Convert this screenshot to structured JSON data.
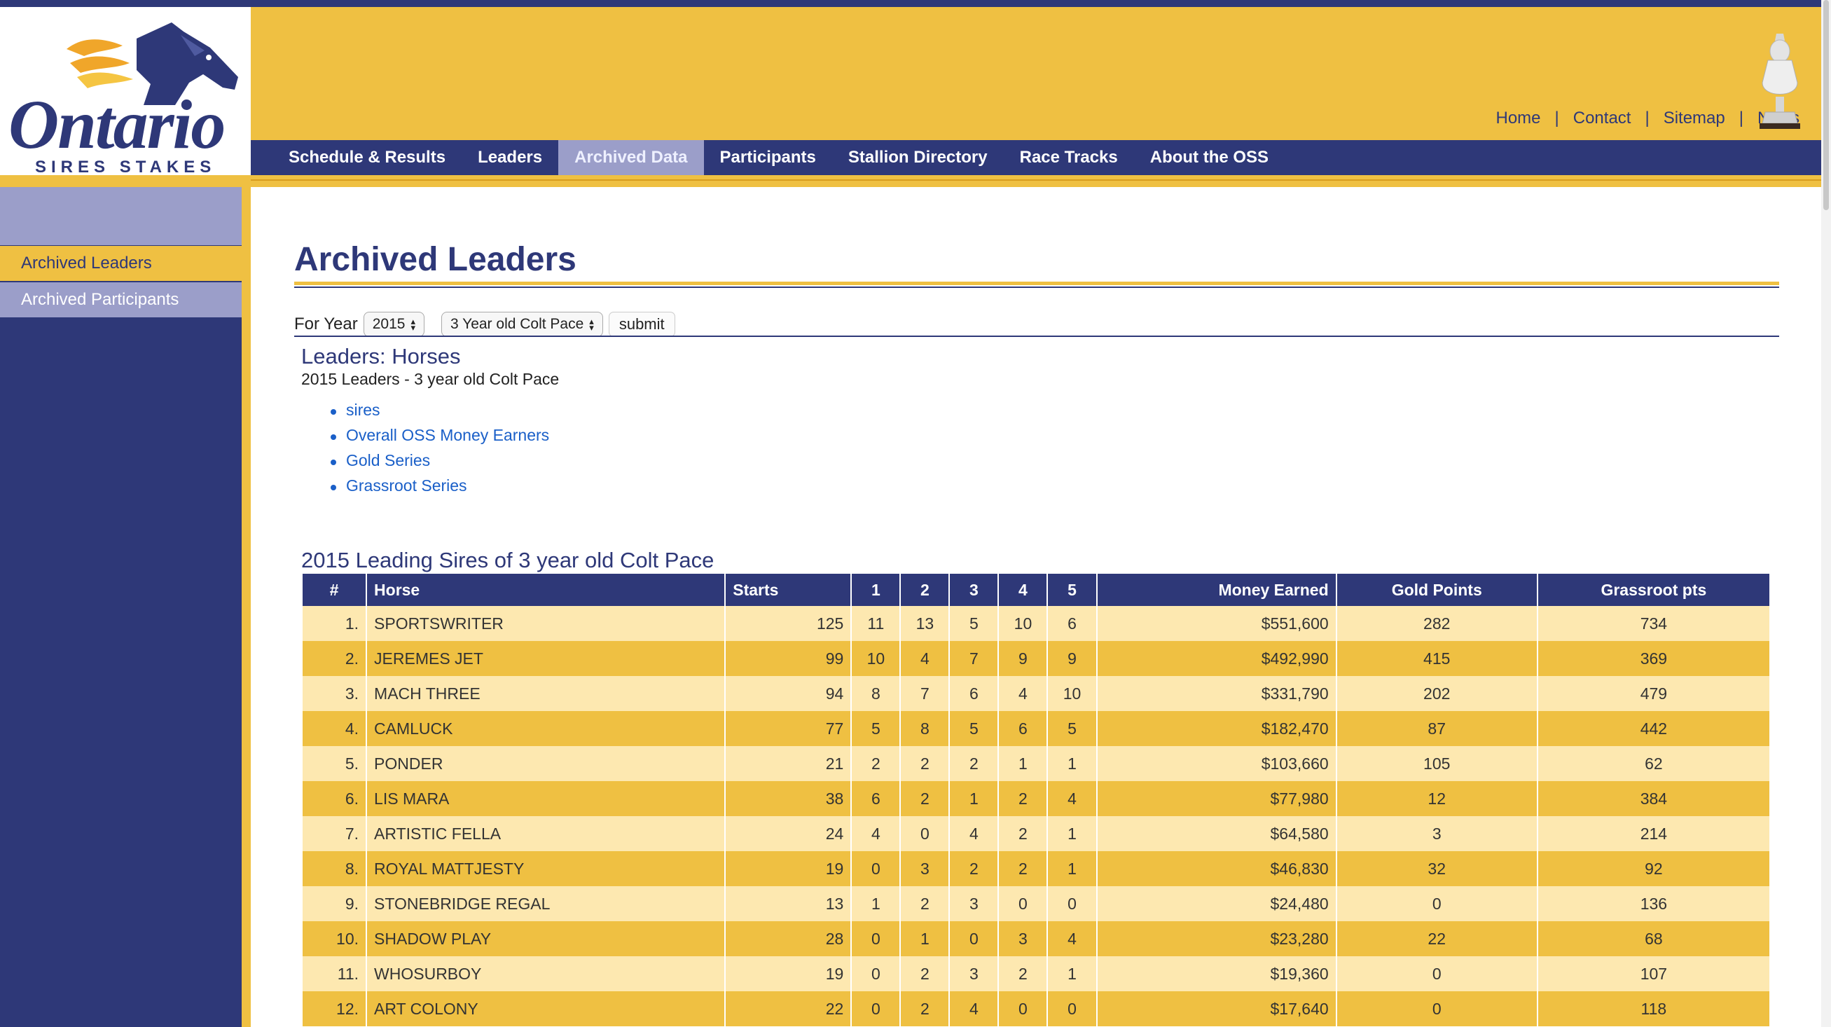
{
  "logo": {
    "brand": "Ontario",
    "tagline": "SIRES STAKES"
  },
  "util_nav": [
    "Home",
    "Contact",
    "Sitemap",
    "News"
  ],
  "main_nav": [
    {
      "label": "Schedule & Results",
      "active": false
    },
    {
      "label": "Leaders",
      "active": false
    },
    {
      "label": "Archived Data",
      "active": true
    },
    {
      "label": "Participants",
      "active": false
    },
    {
      "label": "Stallion Directory",
      "active": false
    },
    {
      "label": "Race Tracks",
      "active": false
    },
    {
      "label": "About the OSS",
      "active": false
    }
  ],
  "sidebar": {
    "items": [
      "Archived Leaders",
      "Archived Participants"
    ]
  },
  "page_title": "Archived Leaders",
  "filter": {
    "label": "For Year",
    "year": "2015",
    "category": "3 Year old Colt Pace",
    "submit": "submit"
  },
  "leaders": {
    "heading": "Leaders: Horses",
    "subheading": "2015 Leaders - 3 year old Colt Pace",
    "links": [
      "sires",
      "Overall OSS Money Earners",
      "Gold Series",
      "Grassroot Series"
    ]
  },
  "table": {
    "caption": "2015 Leading Sires of 3 year old Colt Pace",
    "headers": [
      "#",
      "Horse",
      "Starts",
      "1",
      "2",
      "3",
      "4",
      "5",
      "Money Earned",
      "Gold Points",
      "Grassroot pts"
    ],
    "rows": [
      [
        "1.",
        "SPORTSWRITER",
        "125",
        "11",
        "13",
        "5",
        "10",
        "6",
        "$551,600",
        "282",
        "734"
      ],
      [
        "2.",
        "JEREMES JET",
        "99",
        "10",
        "4",
        "7",
        "9",
        "9",
        "$492,990",
        "415",
        "369"
      ],
      [
        "3.",
        "MACH THREE",
        "94",
        "8",
        "7",
        "6",
        "4",
        "10",
        "$331,790",
        "202",
        "479"
      ],
      [
        "4.",
        "CAMLUCK",
        "77",
        "5",
        "8",
        "5",
        "6",
        "5",
        "$182,470",
        "87",
        "442"
      ],
      [
        "5.",
        "PONDER",
        "21",
        "2",
        "2",
        "2",
        "1",
        "1",
        "$103,660",
        "105",
        "62"
      ],
      [
        "6.",
        "LIS MARA",
        "38",
        "6",
        "2",
        "1",
        "2",
        "4",
        "$77,980",
        "12",
        "384"
      ],
      [
        "7.",
        "ARTISTIC FELLA",
        "24",
        "4",
        "0",
        "4",
        "2",
        "1",
        "$64,580",
        "3",
        "214"
      ],
      [
        "8.",
        "ROYAL MATTJESTY",
        "19",
        "0",
        "3",
        "2",
        "2",
        "1",
        "$46,830",
        "32",
        "92"
      ],
      [
        "9.",
        "STONEBRIDGE REGAL",
        "13",
        "1",
        "2",
        "3",
        "0",
        "0",
        "$24,480",
        "0",
        "136"
      ],
      [
        "10.",
        "SHADOW PLAY",
        "28",
        "0",
        "1",
        "0",
        "3",
        "4",
        "$23,280",
        "22",
        "68"
      ],
      [
        "11.",
        "WHOSURBOY",
        "19",
        "0",
        "2",
        "3",
        "2",
        "1",
        "$19,360",
        "0",
        "107"
      ],
      [
        "12.",
        "ART COLONY",
        "22",
        "0",
        "2",
        "4",
        "0",
        "0",
        "$17,640",
        "0",
        "118"
      ]
    ]
  },
  "colors": {
    "navy": "#2e3878",
    "gold": "#efc042",
    "lavender": "#9b9ec9",
    "row_light": "#fde8b0",
    "link": "#1a5fc8"
  }
}
